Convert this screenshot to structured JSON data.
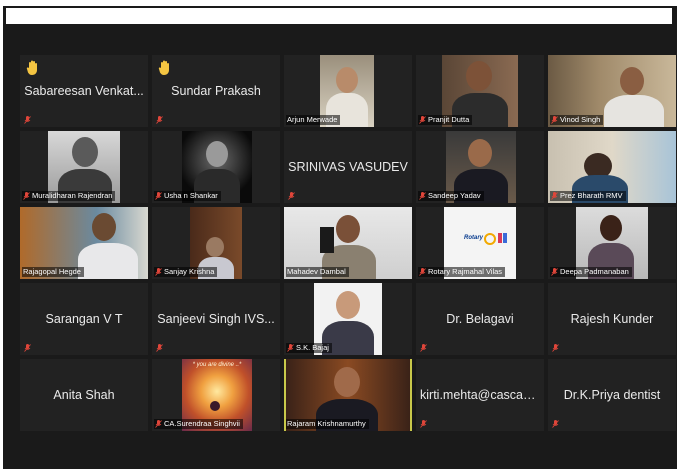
{
  "participants": [
    {
      "name": "Sabareesan Venkat...",
      "display": "center",
      "hand": true,
      "mic": true
    },
    {
      "name": "Sundar Prakash",
      "display": "center",
      "hand": true,
      "mic": true
    },
    {
      "name": "Arjun Merwade",
      "display": "video",
      "mic": false
    },
    {
      "name": "Pranjit Dutta",
      "display": "video",
      "mic": true
    },
    {
      "name": "Vinod Singh",
      "display": "video",
      "mic": true
    },
    {
      "name": "Muralidharan Rajendran",
      "display": "video",
      "mic": true
    },
    {
      "name": "Usha n Shankar",
      "display": "video",
      "mic": true
    },
    {
      "name": "SRINIVAS VASUDEV",
      "display": "center",
      "hand": false,
      "mic": true
    },
    {
      "name": "Sandeep Yadav",
      "display": "video",
      "mic": true
    },
    {
      "name": "Prez Bharath RMV",
      "display": "video",
      "mic": true
    },
    {
      "name": "Rajagopal Hegde",
      "display": "video",
      "mic": false
    },
    {
      "name": "Sanjay Krishna",
      "display": "video",
      "mic": true
    },
    {
      "name": "Mahadev Dambal",
      "display": "video",
      "mic": false
    },
    {
      "name": "Rotary Rajmahal Vilas",
      "display": "video",
      "mic": true
    },
    {
      "name": "Deepa Padmanaban",
      "display": "video",
      "mic": true
    },
    {
      "name": "Sarangan V T",
      "display": "center",
      "hand": false,
      "mic": true
    },
    {
      "name": "Sanjeevi Singh IVS...",
      "display": "center",
      "hand": false,
      "mic": true
    },
    {
      "name": "S.K. Bajaj",
      "display": "video",
      "mic": true
    },
    {
      "name": "Dr. Belagavi",
      "display": "center",
      "hand": false,
      "mic": true
    },
    {
      "name": "Rajesh Kunder",
      "display": "center",
      "hand": false,
      "mic": true
    },
    {
      "name": "Anita Shah",
      "display": "center",
      "hand": false,
      "mic": false
    },
    {
      "name": "CA.Surendraa Singhvii",
      "display": "video",
      "mic": true
    },
    {
      "name": "Rajaram Krishnamurthy",
      "display": "video",
      "mic": false,
      "active": true
    },
    {
      "name": "kirti.mehta@cascad...",
      "display": "center",
      "hand": false,
      "mic": true
    },
    {
      "name": "Dr.K.Priya dentist",
      "display": "center",
      "hand": false,
      "mic": true
    }
  ],
  "rotary_logo_text": "Rotary",
  "divine_text": "* you are divine ..*",
  "colors": {
    "tile_bg": "#222222",
    "frame_bg": "#1a1a1a",
    "muted_mic": "#e0463a",
    "hand": "#f4c542",
    "active_border": "#c8c84a"
  }
}
